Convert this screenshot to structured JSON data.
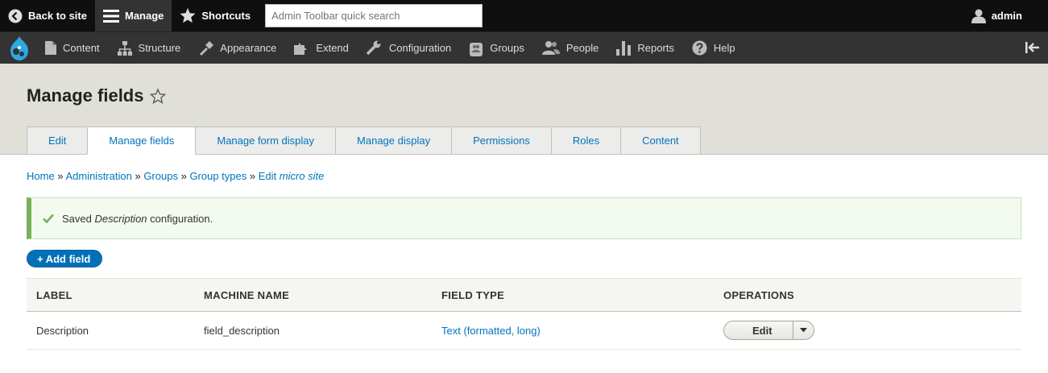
{
  "toolbar": {
    "back_label": "Back to site",
    "manage_label": "Manage",
    "shortcuts_label": "Shortcuts",
    "search_placeholder": "Admin Toolbar quick search",
    "user_label": "admin"
  },
  "tray": {
    "items": [
      {
        "label": "Content",
        "icon": "page-icon"
      },
      {
        "label": "Structure",
        "icon": "structure-icon"
      },
      {
        "label": "Appearance",
        "icon": "paintbrush-icon"
      },
      {
        "label": "Extend",
        "icon": "puzzle-icon"
      },
      {
        "label": "Configuration",
        "icon": "wrench-icon"
      },
      {
        "label": "Groups",
        "icon": "groups-icon"
      },
      {
        "label": "People",
        "icon": "people-icon"
      },
      {
        "label": "Reports",
        "icon": "bar-chart-icon"
      },
      {
        "label": "Help",
        "icon": "help-icon"
      }
    ]
  },
  "header": {
    "title": "Manage fields",
    "tabs": [
      {
        "label": "Edit",
        "active": false
      },
      {
        "label": "Manage fields",
        "active": true
      },
      {
        "label": "Manage form display",
        "active": false
      },
      {
        "label": "Manage display",
        "active": false
      },
      {
        "label": "Permissions",
        "active": false
      },
      {
        "label": "Roles",
        "active": false
      },
      {
        "label": "Content",
        "active": false
      }
    ]
  },
  "breadcrumb": {
    "items": [
      "Home",
      "Administration",
      "Groups",
      "Group types"
    ],
    "last_prefix": "Edit",
    "last_em": "micro site",
    "separator": "»"
  },
  "message": {
    "prefix": "Saved",
    "em": "Description",
    "suffix": "configuration."
  },
  "add_field_label": "+ Add field",
  "table": {
    "headers": [
      "LABEL",
      "MACHINE NAME",
      "FIELD TYPE",
      "OPERATIONS"
    ],
    "rows": [
      {
        "label": "Description",
        "machine_name": "field_description",
        "field_type": "Text (formatted, long)",
        "operation": "Edit"
      }
    ]
  },
  "colors": {
    "toolbar_bg": "#0f0f0f",
    "tray_bg": "#333333",
    "header_bg": "#e0e0d8",
    "link": "#0074bd",
    "status_green": "#77b259",
    "button_blue": "#0071b8"
  }
}
